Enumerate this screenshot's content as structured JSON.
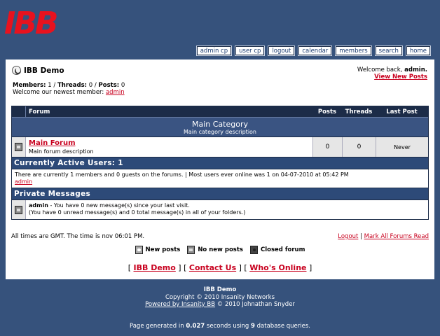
{
  "logo_text": "IBB",
  "nav": [
    "admin cp",
    "user cp",
    "logout",
    "calendar",
    "members",
    "search",
    "home"
  ],
  "board": {
    "title": "IBB Demo",
    "members_label": "Members:",
    "members": "1",
    "threads_label": "Threads:",
    "threads": "0",
    "posts_label": "Posts:",
    "posts": "0",
    "newest_prefix": "Welcome our newest member:",
    "newest_member": "admin"
  },
  "welcome": {
    "prefix": "Welcome back,",
    "user": "admin.",
    "view_new": "View New Posts"
  },
  "table": {
    "headers": {
      "forum": "Forum",
      "posts": "Posts",
      "threads": "Threads",
      "last_post": "Last Post"
    },
    "category": {
      "name": "Main Category",
      "description": "Main category description"
    },
    "forums": [
      {
        "name": "Main Forum",
        "description": "Main forum description",
        "posts": "0",
        "threads": "0",
        "last_post": "Never"
      }
    ]
  },
  "active_users": {
    "title": "Currently Active Users: 1",
    "text": "There are currently 1 members and 0 guests on the forums. | Most users ever online was 1 on 04-07-2010 at 05:42 PM",
    "user": "admin"
  },
  "private_messages": {
    "title": "Private Messages",
    "user": "admin",
    "line1": " - You have 0 new message(s) since your last visit.",
    "line2": "(You have 0 unread message(s) and 0 total message(s) in all of your folders.)"
  },
  "times": "All times are GMT. The time is nov 06:01 PM.",
  "footer_links": {
    "logout": "Logout",
    "sep": "|",
    "mark_read": "Mark All Forums Read"
  },
  "legend": {
    "new_posts": "New posts",
    "no_new_posts": "No new posts",
    "closed_forum": "Closed forum"
  },
  "bottom_links": [
    "IBB Demo",
    "Contact Us",
    "Who's Online"
  ],
  "page_footer": {
    "title": "IBB Demo",
    "copyright": "Copyright © 2010 Insanity Networks",
    "powered_link": "Powered by Insanity BB",
    "powered_rest": " © 2010 Johnathan Snyder"
  },
  "page_generated": {
    "prefix": "Page generated in ",
    "seconds": "0.027",
    "middle": " seconds using ",
    "queries": "9",
    "suffix": " database queries."
  },
  "colors": {
    "background": "#36527c",
    "header_row": "#1c2c48",
    "category_row": "#3a5482",
    "link": "#c8001e",
    "logo": "#e8121e"
  }
}
